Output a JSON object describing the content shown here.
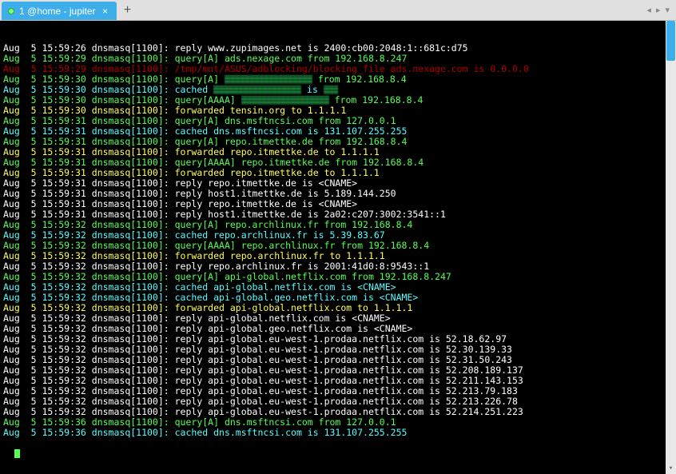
{
  "tab": {
    "title": "1 @home - jupiter",
    "close_glyph": "×"
  },
  "newtab_glyph": "+",
  "nav": {
    "left": "◂",
    "right": "▸",
    "menu": "▾"
  },
  "colors": {
    "accent": "#3daee9",
    "term_bg": "#000000"
  },
  "redacted_short": "██",
  "lines": [
    {
      "c": "white",
      "ts": "Aug  5 15:59:26",
      "rest": "reply www.zupimages.net is 2400:cb00:2048:1::681c:d75"
    },
    {
      "c": "green",
      "ts": "Aug  5 15:59:29",
      "rest": "query[A] ads.nexage.com from 192.168.8.247"
    },
    {
      "c": "darkred",
      "ts": "Aug  5 15:59:29",
      "rest": "/tmp/mnt/ASUS/adblocking/blocking_file ads.nexage.com is 0.0.0.0"
    },
    {
      "c": "green",
      "ts": "Aug  5 15:59:30",
      "rest_pre": "query[A] ",
      "pixelated": true,
      "rest_post": " from 192.168.8.4"
    },
    {
      "c": "cyan",
      "ts": "Aug  5 15:59:30",
      "rest_pre": "cached ",
      "pixelated": true,
      "rest_mid": " is",
      "short_redact": true
    },
    {
      "c": "green",
      "ts": "Aug  5 15:59:30",
      "rest_pre": "query[AAAA] ",
      "pixelated": true,
      "rest_post": " from 192.168.8.4"
    },
    {
      "c": "yellow",
      "ts": "Aug  5 15:59:30",
      "rest": "forwarded tensin.org to 1.1.1.1"
    },
    {
      "c": "green",
      "ts": "Aug  5 15:59:31",
      "rest": "query[A] dns.msftncsi.com from 127.0.0.1"
    },
    {
      "c": "cyan",
      "ts": "Aug  5 15:59:31",
      "rest": "cached dns.msftncsi.com is 131.107.255.255"
    },
    {
      "c": "green",
      "ts": "Aug  5 15:59:31",
      "rest": "query[A] repo.itmettke.de from 192.168.8.4"
    },
    {
      "c": "yellow",
      "ts": "Aug  5 15:59:31",
      "rest": "forwarded repo.itmettke.de to 1.1.1.1"
    },
    {
      "c": "green",
      "ts": "Aug  5 15:59:31",
      "rest": "query[AAAA] repo.itmettke.de from 192.168.8.4"
    },
    {
      "c": "yellow",
      "ts": "Aug  5 15:59:31",
      "rest": "forwarded repo.itmettke.de to 1.1.1.1"
    },
    {
      "c": "white",
      "ts": "Aug  5 15:59:31",
      "rest": "reply repo.itmettke.de is <CNAME>"
    },
    {
      "c": "white",
      "ts": "Aug  5 15:59:31",
      "rest": "reply host1.itmettke.de is 5.189.144.250"
    },
    {
      "c": "white",
      "ts": "Aug  5 15:59:31",
      "rest": "reply repo.itmettke.de is <CNAME>"
    },
    {
      "c": "white",
      "ts": "Aug  5 15:59:31",
      "rest": "reply host1.itmettke.de is 2a02:c207:3002:3541::1"
    },
    {
      "c": "green",
      "ts": "Aug  5 15:59:32",
      "rest": "query[A] repo.archlinux.fr from 192.168.8.4"
    },
    {
      "c": "cyan",
      "ts": "Aug  5 15:59:32",
      "rest": "cached repo.archlinux.fr is 5.39.83.67"
    },
    {
      "c": "green",
      "ts": "Aug  5 15:59:32",
      "rest": "query[AAAA] repo.archlinux.fr from 192.168.8.4"
    },
    {
      "c": "yellow",
      "ts": "Aug  5 15:59:32",
      "rest": "forwarded repo.archlinux.fr to 1.1.1.1"
    },
    {
      "c": "white",
      "ts": "Aug  5 15:59:32",
      "rest": "reply repo.archlinux.fr is 2001:41d0:8:9543::1"
    },
    {
      "c": "green",
      "ts": "Aug  5 15:59:32",
      "rest": "query[A] api-global.netflix.com from 192.168.8.247"
    },
    {
      "c": "cyan",
      "ts": "Aug  5 15:59:32",
      "rest": "cached api-global.netflix.com is <CNAME>"
    },
    {
      "c": "cyan",
      "ts": "Aug  5 15:59:32",
      "rest": "cached api-global.geo.netflix.com is <CNAME>"
    },
    {
      "c": "yellow",
      "ts": "Aug  5 15:59:32",
      "rest": "forwarded api-global.netflix.com to 1.1.1.1"
    },
    {
      "c": "white",
      "ts": "Aug  5 15:59:32",
      "rest": "reply api-global.netflix.com is <CNAME>"
    },
    {
      "c": "white",
      "ts": "Aug  5 15:59:32",
      "rest": "reply api-global.geo.netflix.com is <CNAME>"
    },
    {
      "c": "white",
      "ts": "Aug  5 15:59:32",
      "rest": "reply api-global.eu-west-1.prodaa.netflix.com is 52.18.62.97"
    },
    {
      "c": "white",
      "ts": "Aug  5 15:59:32",
      "rest": "reply api-global.eu-west-1.prodaa.netflix.com is 52.30.139.33"
    },
    {
      "c": "white",
      "ts": "Aug  5 15:59:32",
      "rest": "reply api-global.eu-west-1.prodaa.netflix.com is 52.31.50.243"
    },
    {
      "c": "white",
      "ts": "Aug  5 15:59:32",
      "rest": "reply api-global.eu-west-1.prodaa.netflix.com is 52.208.189.137"
    },
    {
      "c": "white",
      "ts": "Aug  5 15:59:32",
      "rest": "reply api-global.eu-west-1.prodaa.netflix.com is 52.211.143.153"
    },
    {
      "c": "white",
      "ts": "Aug  5 15:59:32",
      "rest": "reply api-global.eu-west-1.prodaa.netflix.com is 52.213.79.183"
    },
    {
      "c": "white",
      "ts": "Aug  5 15:59:32",
      "rest": "reply api-global.eu-west-1.prodaa.netflix.com is 52.213.226.78"
    },
    {
      "c": "white",
      "ts": "Aug  5 15:59:32",
      "rest": "reply api-global.eu-west-1.prodaa.netflix.com is 52.214.251.223"
    },
    {
      "c": "green",
      "ts": "Aug  5 15:59:36",
      "rest": "query[A] dns.msftncsi.com from 127.0.0.1"
    },
    {
      "c": "cyan",
      "ts": "Aug  5 15:59:36",
      "rest": "cached dns.msftncsi.com is 131.107.255.255"
    }
  ],
  "proc_prefix": "dnsmasq[1100]: "
}
